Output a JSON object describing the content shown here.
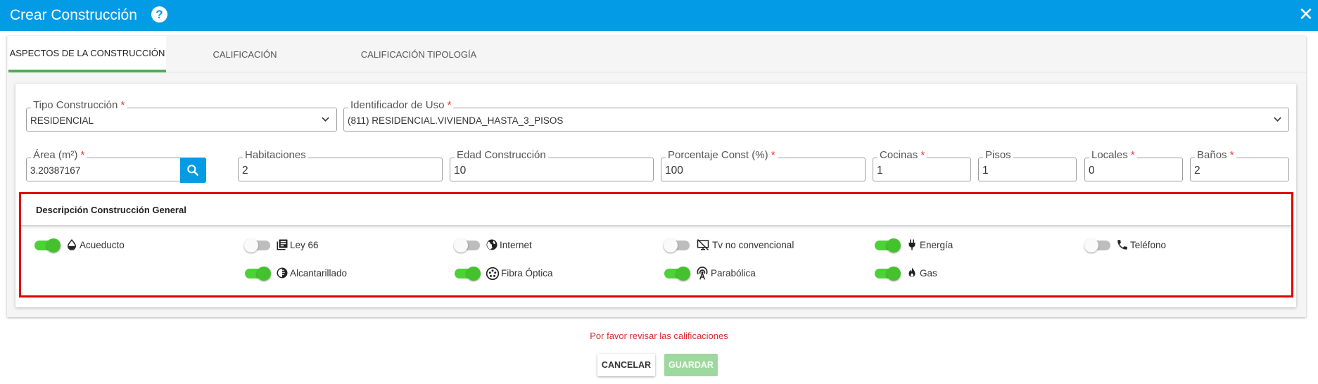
{
  "header": {
    "title": "Crear Construcción",
    "help_glyph": "?",
    "close_glyph": "✕",
    "bg_color": "#039be5"
  },
  "tabs": [
    {
      "label": "ASPECTOS DE LA CONSTRUCCIÓN",
      "active": true
    },
    {
      "label": "CALIFICACIÓN",
      "active": false
    },
    {
      "label": "CALIFICACIÓN TIPOLOGÍA",
      "active": false
    }
  ],
  "form": {
    "tipo_construccion": {
      "label": "Tipo Construcción",
      "required": "*",
      "value": "RESIDENCIAL"
    },
    "identificador_uso": {
      "label": "Identificador de Uso",
      "required": "*",
      "value": "(811) RESIDENCIAL.VIVIENDA_HASTA_3_PISOS"
    },
    "area": {
      "label": "Área (m²)",
      "required": "*",
      "value": "3.20387167",
      "button_icon": "search-icon"
    },
    "habitaciones": {
      "label": "Habitaciones",
      "value": "2"
    },
    "edad": {
      "label": "Edad Construcción",
      "value": "10"
    },
    "porcentaje": {
      "label": "Porcentaje Const (%)",
      "required": "*",
      "value": "100"
    },
    "cocinas": {
      "label": "Cocinas",
      "required": "*",
      "value": "1"
    },
    "pisos": {
      "label": "Pisos",
      "value": "1"
    },
    "locales": {
      "label": "Locales",
      "required": "*",
      "value": "0"
    },
    "banos": {
      "label": "Baños",
      "required": "*",
      "value": "2"
    }
  },
  "description": {
    "title": "Descripción Construcción General",
    "services": [
      {
        "key": "acueducto",
        "label": "Acueducto",
        "on": true,
        "icon": "water-drop-icon"
      },
      {
        "key": "ley66",
        "label": "Ley 66",
        "on": false,
        "icon": "library-books-icon"
      },
      {
        "key": "internet",
        "label": "Internet",
        "on": false,
        "icon": "globe-icon"
      },
      {
        "key": "tv",
        "label": "Tv no convencional",
        "on": false,
        "icon": "tv-off-icon"
      },
      {
        "key": "energia",
        "label": "Energía",
        "on": true,
        "icon": "plug-icon"
      },
      {
        "key": "telefono",
        "label": "Teléfono",
        "on": false,
        "icon": "phone-icon"
      },
      {
        "key": "alcantarillado",
        "label": "Alcantarillado",
        "on": true,
        "icon": "contrast-icon"
      },
      {
        "key": "fibra",
        "label": "Fibra Óptica",
        "on": true,
        "icon": "fiber-icon"
      },
      {
        "key": "parabolica",
        "label": "Parabólica",
        "on": true,
        "icon": "antenna-icon"
      },
      {
        "key": "gas",
        "label": "Gas",
        "on": true,
        "icon": "flame-icon"
      }
    ]
  },
  "footer": {
    "message": "Por favor revisar las calificaciones",
    "cancel_label": "CANCELAR",
    "save_label": "GUARDAR"
  }
}
